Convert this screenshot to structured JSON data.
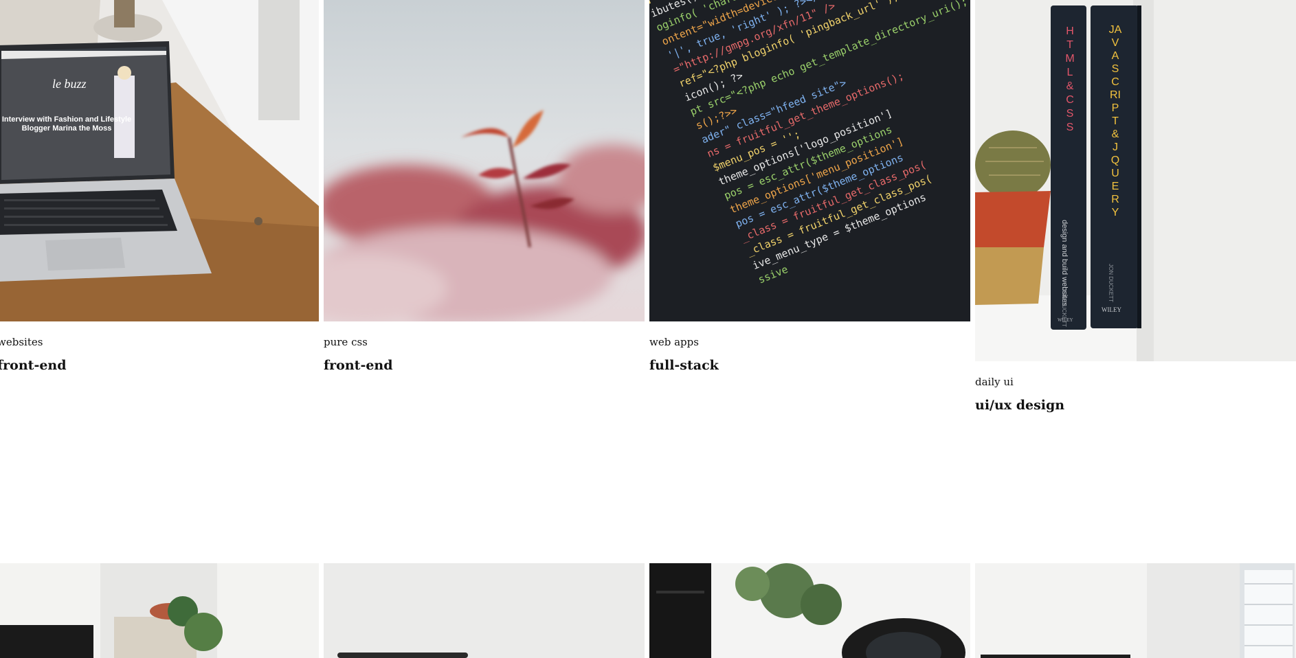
{
  "gallery": {
    "row1": [
      {
        "tag": "websites",
        "title": "front-end",
        "image": "laptop-desk-photo",
        "screen_heading": "le buzz",
        "screen_text": "Interview with Fashion and Lifestyle Blogger Marina the Moss"
      },
      {
        "tag": "pure css",
        "title": "front-end",
        "image": "red-plant-photo"
      },
      {
        "tag": "web apps",
        "title": "full-stack",
        "image": "code-screen-photo",
        "code_lines": [
          "]<!-- ?>",
          "ibutes(); ?>",
          "oginfo( 'charset' ); ?>\" />",
          "ontent=\"width=device-width\" />",
          "'|', true, 'right' ); ?></title>",
          "=\"http://gmpg.org/xfn/11\" />",
          "ref=\"<?php bloginfo( 'pingback_url' ); ?>\"",
          "icon(); ?>",
          "pt src=\"<?php echo get_template_directory_uri();",
          "s();?>>",
          "ader\" class=\"hfeed site\">",
          "ns = fruitful_get_theme_options();",
          "$menu_pos = '';",
          "theme_options['logo_position']",
          "pos = esc_attr($theme_options",
          "theme_options['menu_position']",
          "pos = esc_attr($theme_options",
          "_class = fruitful_get_class_pos(",
          "_class = fruitful_get_class_pos(",
          "ive_menu_type = $theme_options",
          "ssive"
        ]
      },
      {
        "tag": "daily ui",
        "title": "ui/ux design",
        "image": "books-shelf-photo",
        "book1_title": "HTML & CSS",
        "book1_sub": "design and build websites",
        "book1_author": "JON DUCKETT",
        "book1_pub": "WILEY",
        "book2_title": "JAVASCRIPT & JQUERY",
        "book2_author": "JON DUCKETT",
        "book2_pub": "WILEY"
      }
    ],
    "row2": [
      {
        "image": "monitor-plant-photo"
      },
      {
        "image": "white-room-photo"
      },
      {
        "image": "camera-lens-photo"
      },
      {
        "image": "window-laptop-photo"
      }
    ]
  },
  "colors": {
    "wood": "#a9743f",
    "laptop": "#c9cbce",
    "code_bg": "#1c1f24",
    "book_spine": "#1d2530",
    "book_red": "#e2566a",
    "book_yellow": "#f2c23e",
    "pot_red": "#c34a2c"
  }
}
